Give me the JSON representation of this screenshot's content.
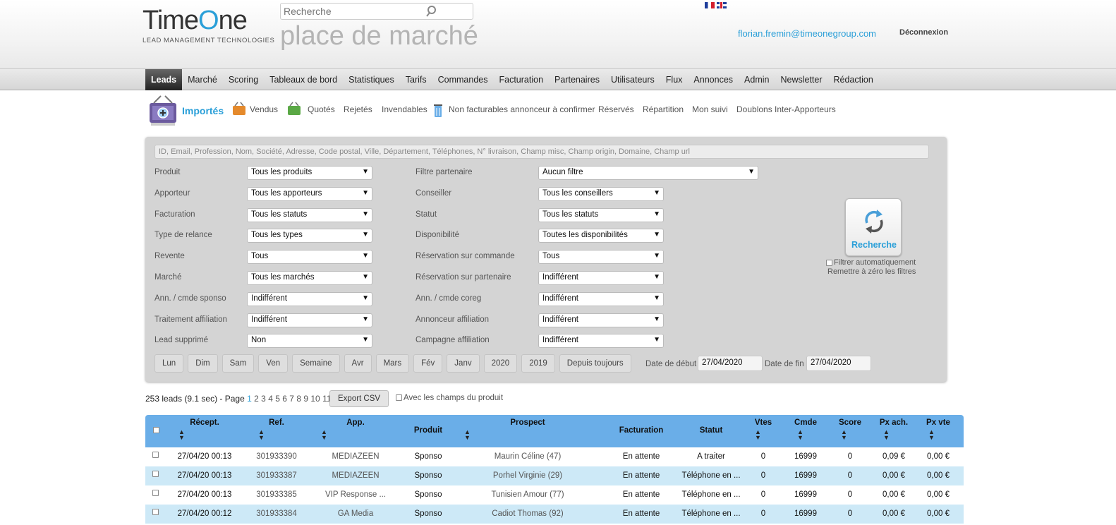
{
  "header": {
    "logo_word_a": "T",
    "logo_word_b": "ime",
    "logo_word_c": "O",
    "logo_word_d": "ne",
    "logo_tagline": "LEAD MANAGEMENT TECHNOLOGIES",
    "search_placeholder": "Recherche",
    "market_title": "place de marché",
    "user_email": "florian.fremin@timeonegroup.com",
    "logout_label": "Déconnexion"
  },
  "nav": {
    "items": [
      "Leads",
      "Marché",
      "Scoring",
      "Tableaux de bord",
      "Statistiques",
      "Tarifs",
      "Commandes",
      "Facturation",
      "Partenaires",
      "Utilisateurs",
      "Flux",
      "Annonces",
      "Admin",
      "Newsletter",
      "Rédaction"
    ],
    "active": "Leads"
  },
  "subnav": {
    "items": [
      "Importés",
      "Vendus",
      "Quotés",
      "Rejetés",
      "Invendables",
      "Non facturables annonceur à confirmer",
      "Réservés",
      "Répartition",
      "Mon suivi",
      "Doublons Inter-Apporteurs"
    ]
  },
  "filters": {
    "search_placeholder": "ID, Email, Profession, Nom, Société, Adresse, Code postal, Ville, Département, Téléphones, N° livraison, Champ misc, Champ origin, Domaine, Champ url",
    "left": [
      {
        "label": "Produit",
        "value": "Tous les produits"
      },
      {
        "label": "Apporteur",
        "value": "Tous les apporteurs"
      },
      {
        "label": "Facturation",
        "value": "Tous les statuts"
      },
      {
        "label": "Type de relance",
        "value": "Tous les types"
      },
      {
        "label": "Revente",
        "value": "Tous"
      },
      {
        "label": "Marché",
        "value": "Tous les marchés"
      },
      {
        "label": "Ann. / cmde sponso",
        "value": "Indifférent"
      },
      {
        "label": "Traitement affiliation",
        "value": "Indifférent"
      },
      {
        "label": "Lead supprimé",
        "value": "Non"
      }
    ],
    "right": [
      {
        "label": "Filtre partenaire",
        "value": "Aucun filtre"
      },
      {
        "label": "Conseiller",
        "value": "Tous les conseillers"
      },
      {
        "label": "Statut",
        "value": "Tous les statuts"
      },
      {
        "label": "Disponibilité",
        "value": "Toutes les disponibilités"
      },
      {
        "label": "Réservation sur commande",
        "value": "Tous"
      },
      {
        "label": "Réservation sur partenaire",
        "value": "Indifférent"
      },
      {
        "label": "Ann. / cmde coreg",
        "value": "Indifférent"
      },
      {
        "label": "Annonceur affiliation",
        "value": "Indifférent"
      },
      {
        "label": "Campagne affiliation",
        "value": "Indifférent"
      }
    ],
    "search_button": "Recherche",
    "auto_filter_label": "Filtrer automatiquement",
    "reset_label": "Remettre à zéro les filtres",
    "period_buttons": [
      "Lun",
      "Dim",
      "Sam",
      "Ven",
      "Semaine",
      "Avr",
      "Mars",
      "Fév",
      "Janv",
      "2020",
      "2019",
      "Depuis toujours"
    ],
    "date_start_label": "Date de début",
    "date_start_value": "27/04/2020",
    "date_end_label": "Date de fin",
    "date_end_value": "27/04/2020"
  },
  "results": {
    "summary": "253 leads (9.1 sec) - Page",
    "pages": [
      "1",
      "2",
      "3",
      "4",
      "5",
      "6",
      "7",
      "8",
      "9",
      "10",
      "11"
    ],
    "current_page": "1",
    "dash": "-",
    "export_label": "Export CSV",
    "with_fields_label": "Avec les champs du produit"
  },
  "table": {
    "columns": [
      "Récept.",
      "Ref.",
      "App.",
      "Produit",
      "Prospect",
      "Facturation",
      "Statut",
      "Vtes",
      "Cmde",
      "Score",
      "Px ach.",
      "Px vte"
    ],
    "rows": [
      [
        "27/04/20 00:13",
        "301933390",
        "MEDIAZEEN",
        "Sponso",
        "Maurin Céline (47)",
        "En attente",
        "A traiter",
        "0",
        "16999",
        "0",
        "0,09 €",
        "0,00 €"
      ],
      [
        "27/04/20 00:13",
        "301933387",
        "MEDIAZEEN",
        "Sponso",
        "Porhel Virginie (29)",
        "En attente",
        "Téléphone en ...",
        "0",
        "16999",
        "0",
        "0,00 €",
        "0,00 €"
      ],
      [
        "27/04/20 00:13",
        "301933385",
        "VIP Response ...",
        "Sponso",
        "Tunisien Amour (77)",
        "En attente",
        "Téléphone en ...",
        "0",
        "16999",
        "0",
        "0,00 €",
        "0,00 €"
      ],
      [
        "27/04/20 00:12",
        "301933384",
        "GA Media",
        "Sponso",
        "Cadiot Thomas (92)",
        "En attente",
        "Téléphone en ...",
        "0",
        "16999",
        "0",
        "0,00 €",
        "0,00 €"
      ]
    ]
  },
  "colors": {
    "accent": "#2a9fd8",
    "table_header": "#6aaee8",
    "row_alt": "#cde9f7",
    "panel": "#d4d4d4"
  }
}
